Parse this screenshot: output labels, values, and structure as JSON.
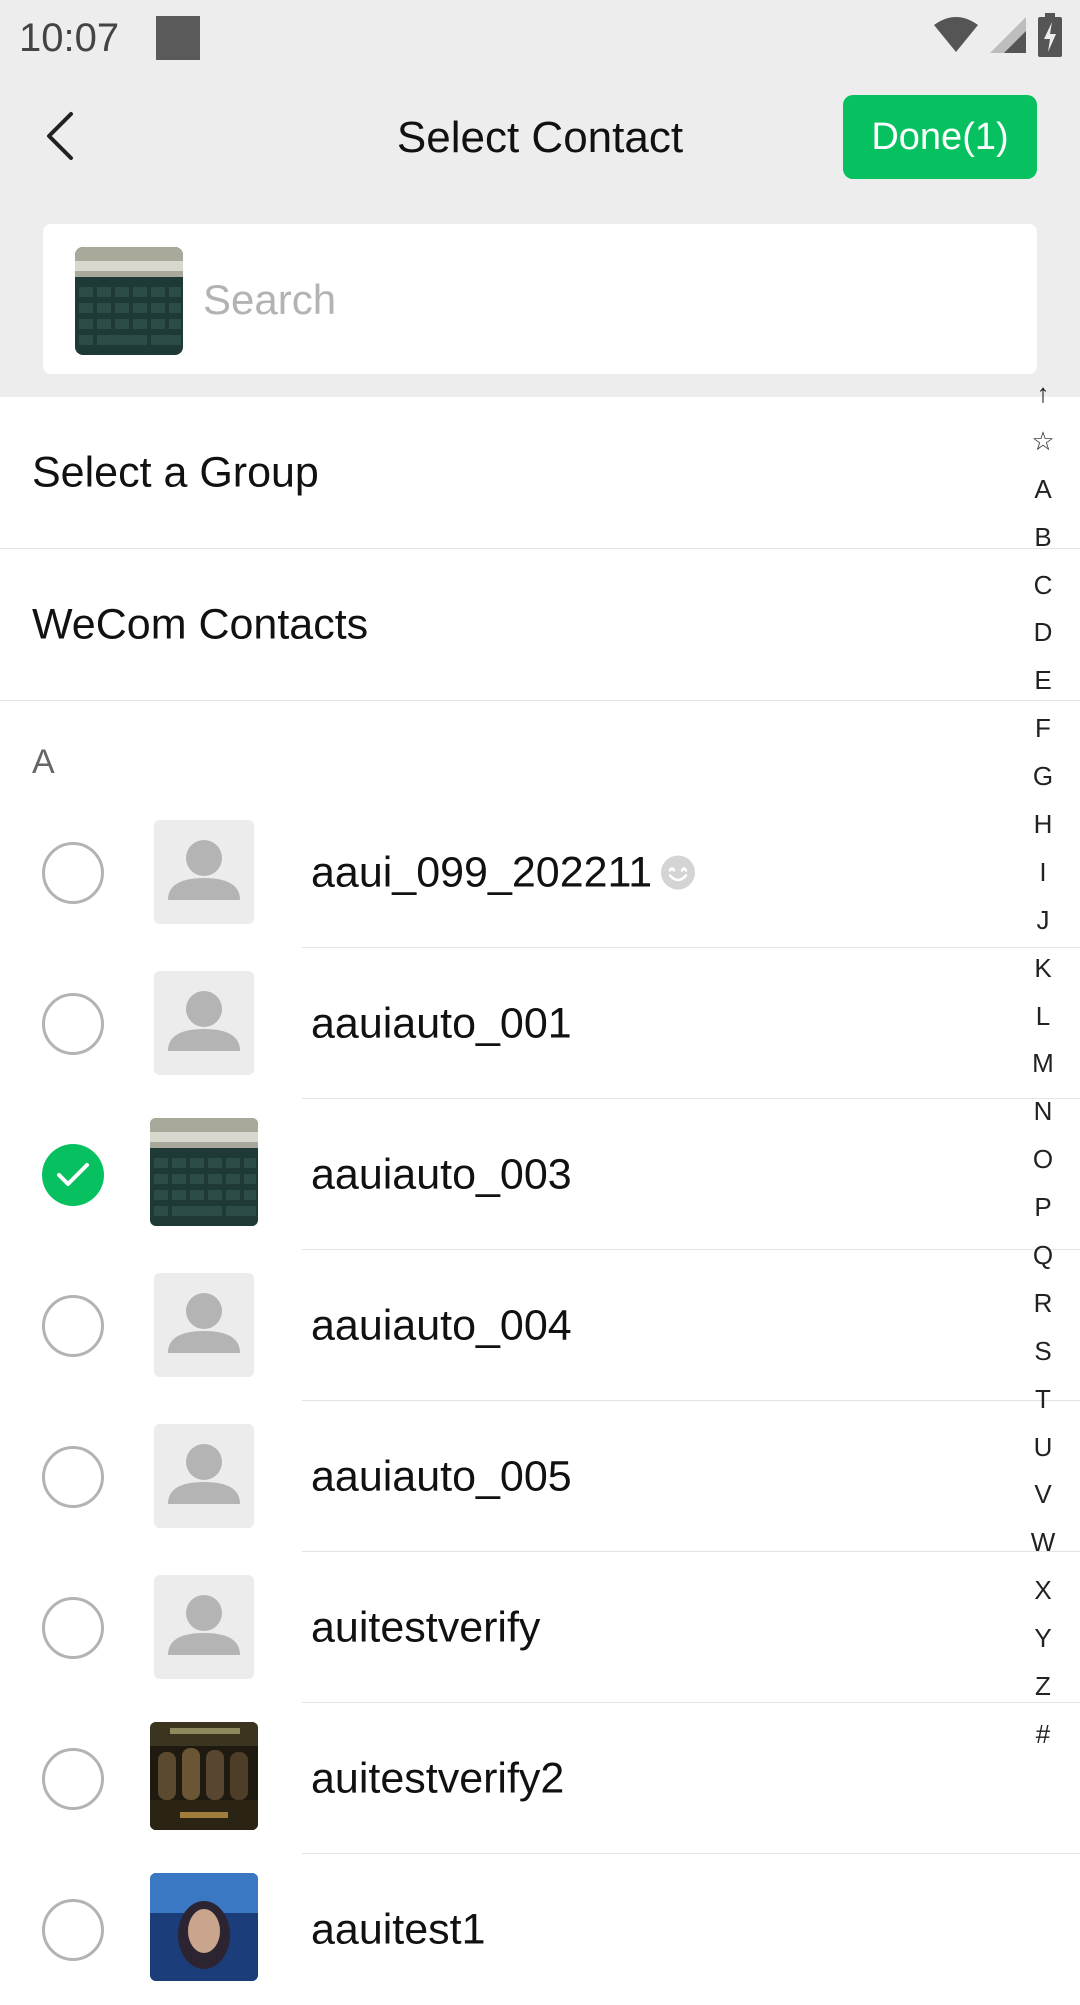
{
  "status_bar": {
    "time": "10:07"
  },
  "nav": {
    "title": "Select Contact",
    "done_label": "Done(1)"
  },
  "search": {
    "placeholder": "Search"
  },
  "menu": {
    "select_group": "Select a Group",
    "wecom_contacts": "WeCom Contacts"
  },
  "section": {
    "header": "A"
  },
  "contacts": [
    {
      "name": "aaui_099_202211",
      "checked": false,
      "avatar": "default-avatar",
      "emoji": "smiley"
    },
    {
      "name": "aauiauto_001",
      "checked": false,
      "avatar": "default-avatar"
    },
    {
      "name": "aauiauto_003",
      "checked": true,
      "avatar": "keyboard-photo"
    },
    {
      "name": "aauiauto_004",
      "checked": false,
      "avatar": "default-avatar"
    },
    {
      "name": "aauiauto_005",
      "checked": false,
      "avatar": "default-avatar"
    },
    {
      "name": "auitestverify",
      "checked": false,
      "avatar": "default-avatar"
    },
    {
      "name": "auitestverify2",
      "checked": false,
      "avatar": "group-photo"
    },
    {
      "name": "aauitest1",
      "checked": false,
      "avatar": "portrait-photo"
    }
  ],
  "index_bar": [
    "↑",
    "☆",
    "A",
    "B",
    "C",
    "D",
    "E",
    "F",
    "G",
    "H",
    "I",
    "J",
    "K",
    "L",
    "M",
    "N",
    "O",
    "P",
    "Q",
    "R",
    "S",
    "T",
    "U",
    "V",
    "W",
    "X",
    "Y",
    "Z",
    "#"
  ],
  "colors": {
    "accent": "#07c160",
    "header_bg": "#ededed"
  }
}
